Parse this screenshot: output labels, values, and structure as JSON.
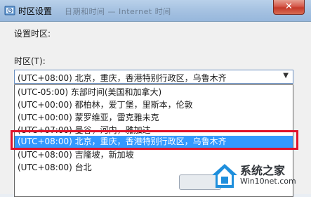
{
  "window": {
    "title": "时区设置",
    "title_ghost": "日期和时间 — Internet 时间",
    "close_label": "✕"
  },
  "form": {
    "heading": "设置时区:",
    "timezone_label": "时区(T):",
    "selected_value": "(UTC+08:00) 北京，重庆，香港特别行政区，乌鲁木齐"
  },
  "dropdown": {
    "options": [
      {
        "label": "(UTC-05:00) 东部时间(美国和加拿大)",
        "selected": false
      },
      {
        "label": "(UTC+00:00) 都柏林，爱丁堡，里斯本，伦敦",
        "selected": false
      },
      {
        "label": "(UTC+00:00) 蒙罗维亚，雷克雅未克",
        "selected": false
      },
      {
        "label": "(UTC+07:00) 曼谷，河内，雅加达",
        "selected": false
      },
      {
        "label": "(UTC+08:00) 北京，重庆，香港特别行政区，乌鲁木齐",
        "selected": true
      },
      {
        "label": "(UTC+08:00) 吉隆坡，新加坡",
        "selected": false
      },
      {
        "label": "(UTC+08:00) 台北",
        "selected": false
      }
    ]
  },
  "watermark": {
    "main": "系统之家",
    "sub": "Win10net.com"
  },
  "colors": {
    "selection": "#3399ff",
    "annotation": "#e0112a"
  }
}
